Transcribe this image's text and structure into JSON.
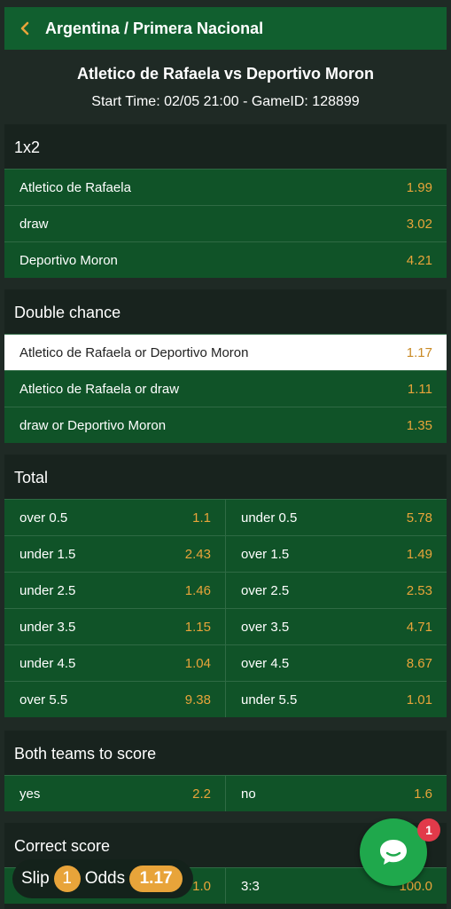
{
  "header": {
    "title": "Argentina / Primera Nacional"
  },
  "match": {
    "title": "Atletico de Rafaela vs Deportivo Moron",
    "subtitle": "Start Time: 02/05 21:00 - GameID: 128899"
  },
  "markets": {
    "one_x_two": {
      "title": "1x2",
      "rows": [
        {
          "label": "Atletico de Rafaela",
          "odd": "1.99"
        },
        {
          "label": "draw",
          "odd": "3.02"
        },
        {
          "label": "Deportivo Moron",
          "odd": "4.21"
        }
      ]
    },
    "double_chance": {
      "title": "Double chance",
      "rows": [
        {
          "label": "Atletico de Rafaela or Deportivo Moron",
          "odd": "1.17",
          "selected": true
        },
        {
          "label": "Atletico de Rafaela or draw",
          "odd": "1.11"
        },
        {
          "label": "draw or Deportivo Moron",
          "odd": "1.35"
        }
      ]
    },
    "total": {
      "title": "Total",
      "rows": [
        {
          "left": {
            "label": "over 0.5",
            "odd": "1.1"
          },
          "right": {
            "label": "under 0.5",
            "odd": "5.78"
          }
        },
        {
          "left": {
            "label": "under 1.5",
            "odd": "2.43"
          },
          "right": {
            "label": "over 1.5",
            "odd": "1.49"
          }
        },
        {
          "left": {
            "label": "under 2.5",
            "odd": "1.46"
          },
          "right": {
            "label": "over 2.5",
            "odd": "2.53"
          }
        },
        {
          "left": {
            "label": "under 3.5",
            "odd": "1.15"
          },
          "right": {
            "label": "over 3.5",
            "odd": "4.71"
          }
        },
        {
          "left": {
            "label": "under 4.5",
            "odd": "1.04"
          },
          "right": {
            "label": "over 4.5",
            "odd": "8.67"
          }
        },
        {
          "left": {
            "label": "over 5.5",
            "odd": "9.38"
          },
          "right": {
            "label": "under 5.5",
            "odd": "1.01"
          }
        }
      ]
    },
    "btts": {
      "title": "Both teams to score",
      "rows": [
        {
          "left": {
            "label": "yes",
            "odd": "2.2"
          },
          "right": {
            "label": "no",
            "odd": "1.6"
          }
        }
      ]
    },
    "correct_score": {
      "title": "Correct score",
      "rows": [
        {
          "left": {
            "label": "",
            "odd": "1.0"
          },
          "right": {
            "label": "3:3",
            "odd": "100.0"
          }
        }
      ]
    }
  },
  "slip": {
    "label": "Slip",
    "count": "1",
    "odds_label": "Odds",
    "odds_value": "1.17"
  },
  "chat": {
    "badge": "1"
  },
  "colors": {
    "accent": "#e8a43a",
    "header_bg": "#115f2f",
    "row_bg": "#105328",
    "chat": "#1fa84c",
    "badge": "#e23a4a"
  }
}
